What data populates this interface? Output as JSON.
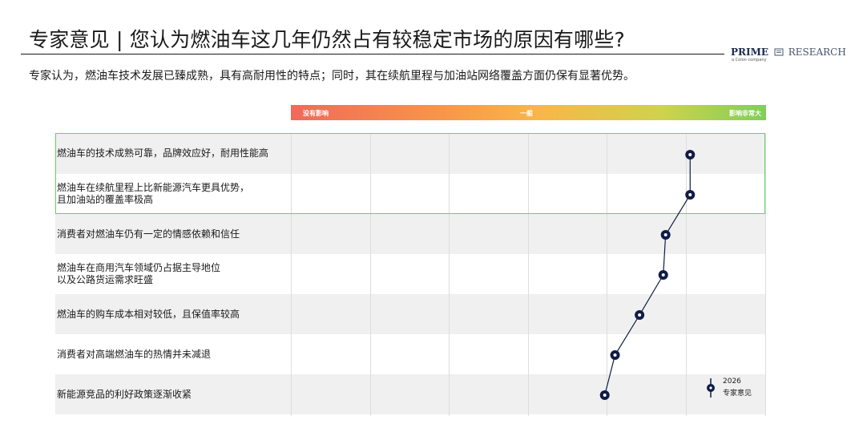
{
  "header": {
    "title": "专家意见 | 您认为燃油车这几年仍然占有较稳定市场的原因有哪些?",
    "subtitle": "专家认为，燃油车技术发展已臻成熟，具有高耐用性的特点；同时，其在续航里程与加油站网络覆盖方面仍保有显著优势。"
  },
  "logo": {
    "brand_bold": "PRIME",
    "brand_rest": "RESEARCH",
    "tagline": "a Colon company"
  },
  "colors": {
    "marker": "#0f1c45",
    "highlight": "#5fd45f",
    "row_shade": "#f0f0f0",
    "gradient_start": "#ef6a5a",
    "gradient_end": "#7fcf58"
  },
  "chart_data": {
    "type": "line",
    "orientation": "horizontal-dot-line",
    "scale": {
      "min": 0,
      "max": 6,
      "labels": {
        "low": "没有影响",
        "mid": "一般",
        "high": "影响非常大"
      }
    },
    "categories": [
      "燃油车的技术成熟可靠，品牌效应好，耐用性能高",
      "燃油车在续航里程上比新能源汽车更具优势，\n且加油站的覆盖率极高",
      "消费者对燃油车仍有一定的情感依赖和信任",
      "燃油车在商用汽车领域仍占据主导地位\n以及公路货运需求旺盛",
      "燃油车的购车成本相对较低，且保值率较高",
      "消费者对高端燃油车的热情并未减退",
      "新能源竞品的利好政策逐渐收紧"
    ],
    "series": [
      {
        "name": "2026 专家意见",
        "values": [
          5.05,
          5.05,
          4.74,
          4.71,
          4.41,
          4.1,
          3.97
        ]
      }
    ],
    "highlighted_rows": [
      0,
      1
    ],
    "legend": {
      "year": "2026",
      "name": "专家意见",
      "placement": "bottom-right"
    }
  }
}
